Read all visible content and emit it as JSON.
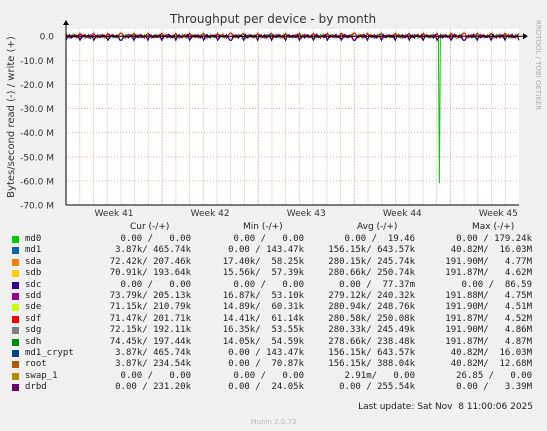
{
  "chart_data": {
    "type": "line",
    "title": "Throughput per device - by month",
    "ylabel": "Bytes/second read (-) / write (+)",
    "side_label": "RRDTOOL / TOBI OETIKER",
    "y_ticks": [
      "0.0",
      "-10.0 M",
      "-20.0 M",
      "-30.0 M",
      "-40.0 M",
      "-50.0 M",
      "-60.0 M",
      "-70.0 M"
    ],
    "y_tick_values": [
      0,
      -10,
      -20,
      -30,
      -40,
      -50,
      -60,
      -70
    ],
    "ylim": [
      -70,
      3
    ],
    "y_unit": "M",
    "x_ticks": [
      "Week 41",
      "Week 42",
      "Week 43",
      "Week 44",
      "Week 45"
    ],
    "x_tick_positions_day": [
      3.5,
      10.5,
      17.5,
      24.5,
      31.5
    ],
    "xlim_days": [
      0,
      33
    ],
    "grid": true,
    "series": [
      {
        "name": "sdh",
        "color": "#00cc00",
        "spike": {
          "day": 27.2,
          "value": -61.0
        }
      },
      {
        "name": "md0",
        "color": "#00cc00"
      },
      {
        "name": "sdd",
        "color": "#cc00cc"
      },
      {
        "name": "sdf",
        "color": "#ff0000"
      },
      {
        "name": "drbd",
        "color": "#330066"
      }
    ]
  },
  "legend": {
    "headers": [
      "Cur (-/+)",
      "Min (-/+)",
      "Avg (-/+)",
      "Max (-/+)"
    ],
    "rows": [
      {
        "name": "md0",
        "color": "#00cc00",
        "cur": "0.00 /   0.00",
        "min": "0.00 /   0.00",
        "avg": "0.00 /  19.46",
        "max": "0.00 / 179.24k"
      },
      {
        "name": "md1",
        "color": "#0066b3",
        "cur": "3.87k/ 465.74k",
        "min": "0.00 / 143.47k",
        "avg": "156.15k/ 643.57k",
        "max": "40.82M/  16.03M"
      },
      {
        "name": "sda",
        "color": "#ff8000",
        "cur": "72.42k/ 207.46k",
        "min": "17.40k/  58.25k",
        "avg": "280.15k/ 245.74k",
        "max": "191.90M/   4.77M"
      },
      {
        "name": "sdb",
        "color": "#ffcc00",
        "cur": "70.91k/ 193.64k",
        "min": "15.56k/  57.39k",
        "avg": "280.66k/ 250.74k",
        "max": "191.87M/   4.62M"
      },
      {
        "name": "sdc",
        "color": "#330099",
        "cur": "0.00 /   0.00",
        "min": "0.00 /   0.00",
        "avg": "0.00 /  77.37m",
        "max": "0.00 /  86.59"
      },
      {
        "name": "sdd",
        "color": "#990099",
        "cur": "73.79k/ 205.13k",
        "min": "16.87k/  53.10k",
        "avg": "279.12k/ 240.32k",
        "max": "191.88M/   4.75M"
      },
      {
        "name": "sde",
        "color": "#ccff00",
        "cur": "71.15k/ 210.79k",
        "min": "14.89k/  60.31k",
        "avg": "280.94k/ 248.76k",
        "max": "191.90M/   4.51M"
      },
      {
        "name": "sdf",
        "color": "#ff0000",
        "cur": "71.47k/ 201.71k",
        "min": "14.41k/  61.14k",
        "avg": "280.58k/ 250.08k",
        "max": "191.87M/   4.52M"
      },
      {
        "name": "sdg",
        "color": "#808080",
        "cur": "72.15k/ 192.11k",
        "min": "16.35k/  53.55k",
        "avg": "280.33k/ 245.49k",
        "max": "191.90M/   4.86M"
      },
      {
        "name": "sdh",
        "color": "#008f00",
        "cur": "74.45k/ 197.44k",
        "min": "14.05k/  54.59k",
        "avg": "278.66k/ 238.48k",
        "max": "191.87M/   4.87M"
      },
      {
        "name": "md1_crypt",
        "color": "#00487d",
        "cur": "3.87k/ 465.74k",
        "min": "0.00 / 143.47k",
        "avg": "156.15k/ 643.57k",
        "max": "40.82M/  16.03M"
      },
      {
        "name": "root",
        "color": "#b35a00",
        "cur": "3.87k/ 234.54k",
        "min": "0.00 /  70.87k",
        "avg": "156.15k/ 388.04k",
        "max": "40.82M/  12.68M"
      },
      {
        "name": "swap_1",
        "color": "#b38f00",
        "cur": "0.00 /   0.00",
        "min": "0.00 /   0.00",
        "avg": "2.91m/   0.00",
        "max": "26.85 /   0.00"
      },
      {
        "name": "drbd",
        "color": "#6b006b",
        "cur": "0.00 / 231.20k",
        "min": "0.00 /  24.05k",
        "avg": "0.00 / 255.54k",
        "max": "0.00 /   3.39M"
      }
    ]
  },
  "footer": {
    "last_update": "Last update: Sat Nov  8 11:00:06 2025",
    "version": "Munin 2.0.73"
  }
}
